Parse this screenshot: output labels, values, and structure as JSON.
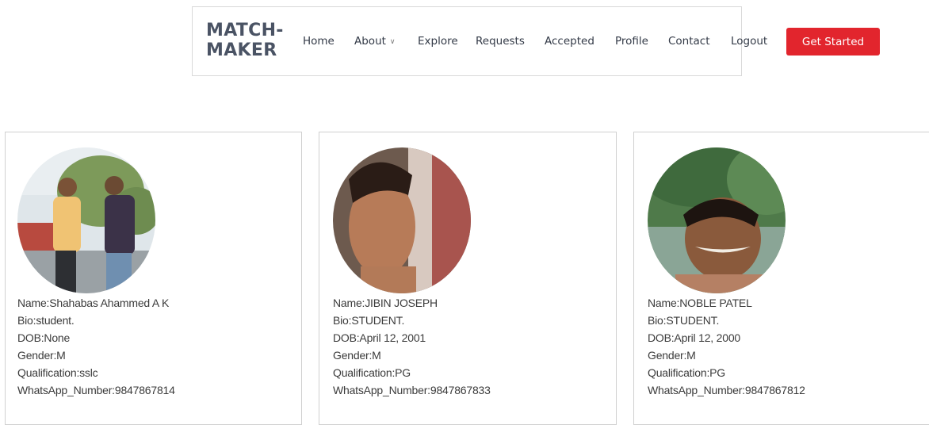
{
  "header": {
    "logo_line1": "MATCH-",
    "logo_line2": "MAKER",
    "nav": {
      "home": "Home",
      "about": "About",
      "explore": "Explore",
      "requests": "Requests",
      "accepted": "Accepted",
      "profile": "Profile",
      "contact": "Contact",
      "logout": "Logout"
    },
    "cta_label": "Get Started",
    "accent_color": "#e2252d"
  },
  "profiles": [
    {
      "name": "Name:Shahabas Ahammed A K",
      "bio": "Bio:student.",
      "dob": "DOB:None",
      "gender": "Gender:M",
      "qualification": "Qualification:sslc",
      "whatsapp": "WhatsApp_Number:9847867814"
    },
    {
      "name": "Name:JIBIN JOSEPH",
      "bio": "Bio:STUDENT.",
      "dob": "DOB:April 12, 2001",
      "gender": "Gender:M",
      "qualification": "Qualification:PG",
      "whatsapp": "WhatsApp_Number:9847867833"
    },
    {
      "name": "Name:NOBLE PATEL",
      "bio": "Bio:STUDENT.",
      "dob": "DOB:April 12, 2000",
      "gender": "Gender:M",
      "qualification": "Qualification:PG",
      "whatsapp": "WhatsApp_Number:9847867812"
    }
  ]
}
